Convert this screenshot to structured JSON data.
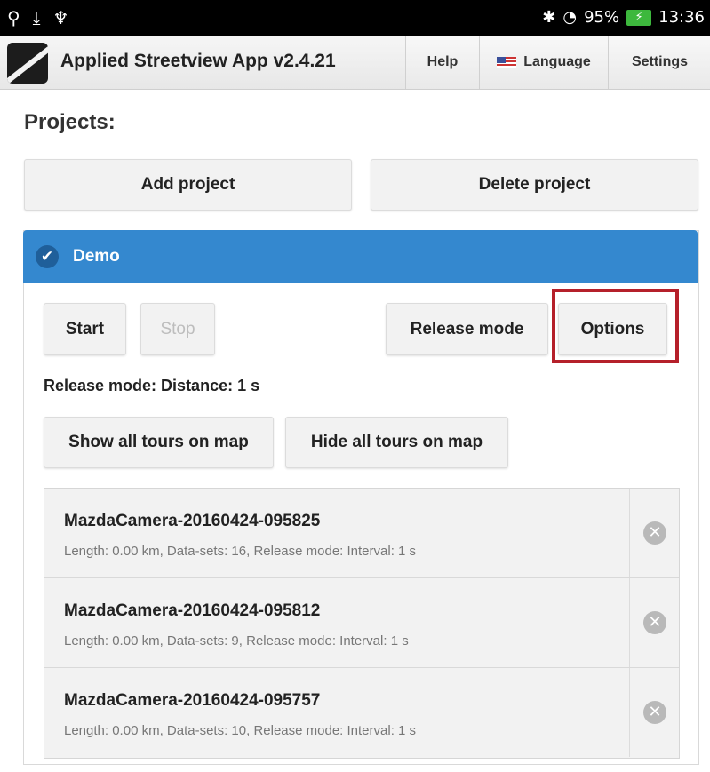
{
  "status_bar": {
    "left_icons": [
      "location-pin-icon",
      "download-icon",
      "usb-icon"
    ],
    "bluetooth_icon": "bluetooth-icon",
    "wifi_icon": "wifi-icon",
    "battery_percent": "95%",
    "time": "13:36"
  },
  "app_bar": {
    "title": "Applied Streetview App v2.4.21",
    "help_label": "Help",
    "language_label": "Language",
    "settings_label": "Settings"
  },
  "projects": {
    "heading": "Projects:",
    "add_label": "Add project",
    "delete_label": "Delete project"
  },
  "project": {
    "name": "Demo",
    "start_label": "Start",
    "stop_label": "Stop",
    "release_mode_label": "Release mode",
    "options_label": "Options",
    "release_mode_status": "Release mode: Distance: 1 s",
    "show_all_label": "Show all tours on map",
    "hide_all_label": "Hide all tours on map",
    "tours": [
      {
        "title": "MazdaCamera-20160424-095825",
        "meta": "Length: 0.00 km, Data-sets: 16, Release mode: Interval: 1 s"
      },
      {
        "title": "MazdaCamera-20160424-095812",
        "meta": "Length: 0.00 km, Data-sets: 9, Release mode: Interval: 1 s"
      },
      {
        "title": "MazdaCamera-20160424-095757",
        "meta": "Length: 0.00 km, Data-sets: 10, Release mode: Interval: 1 s"
      }
    ]
  },
  "colors": {
    "accent": "#3488cf",
    "highlight": "#b5202a"
  }
}
